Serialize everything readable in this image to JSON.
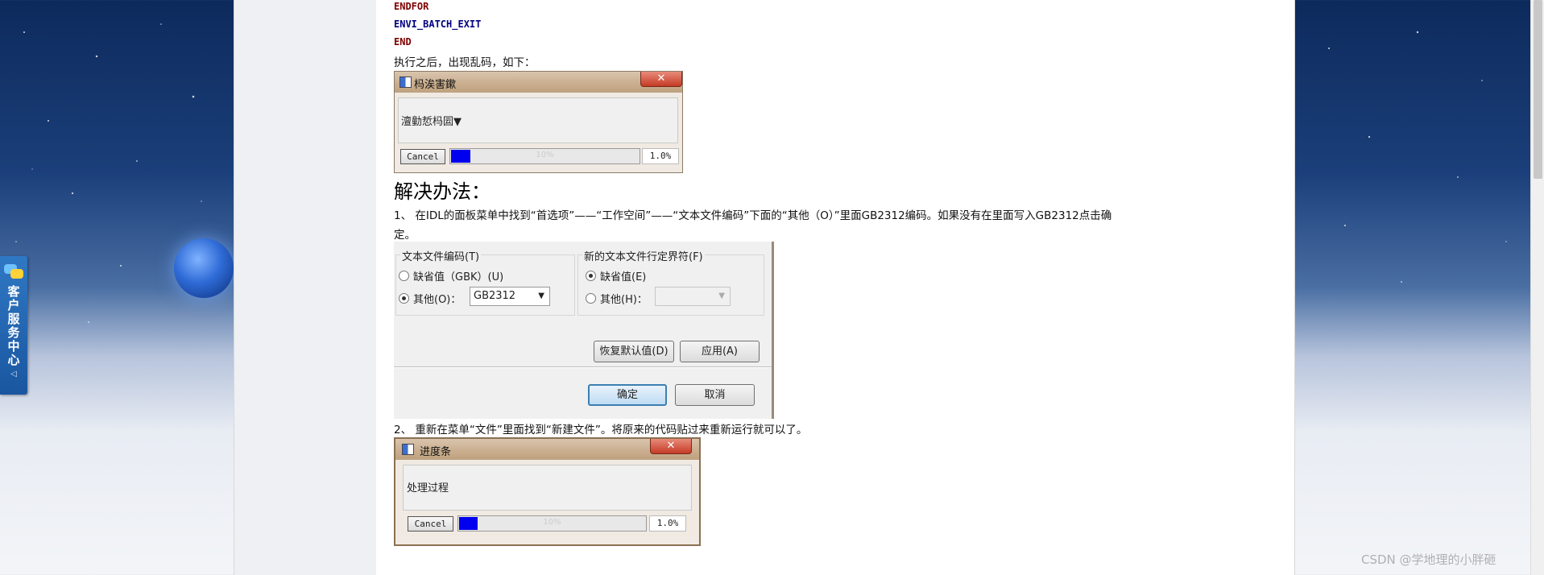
{
  "side_widget": {
    "label": "客户服务中心",
    "arrow": "◁"
  },
  "code_lines": [
    "ENDFOR",
    "ENVI_BATCH_EXIT",
    "END"
  ],
  "para_garbled": "执行之后，出现乱码，如下：",
  "dialog_garbled": {
    "title": "杩涘害鏉",
    "message": "澶勭悊杩囩▼",
    "cancel": "Cancel",
    "progress_faint": "10%",
    "progress": 0.1,
    "percent": "1.0%"
  },
  "heading": "解决办法：",
  "step1_line1": "1、  在IDL的面板菜单中找到“首选项”——“工作空间”——“文本文件编码”下面的“其他（O）”里面GB2312编码。如果没有在里面写入GB2312点击确",
  "step1_line2": "定。",
  "prefs": {
    "encoding_group": "文本文件编码(T)",
    "default_gbk": "缺省值（GBK）(U)",
    "other_o": "其他(O)：",
    "encoding_value": "GB2312",
    "eol_group": "新的文本文件行定界符(F)",
    "eol_default": "缺省值(E)",
    "eol_other": "其他(H)：",
    "eol_value": "",
    "restore_defaults": "恢复默认值(D)",
    "apply": "应用(A)",
    "ok": "确定",
    "cancel": "取消"
  },
  "step2": "2、  重新在菜单“文件”里面找到“新建文件”。将原来的代码贴过来重新运行就可以了。",
  "dialog_fixed": {
    "title": "进度条",
    "message": "处理过程",
    "cancel": "Cancel",
    "progress_faint": "10%",
    "progress": 0.1,
    "percent": "1.0%"
  },
  "watermark": "CSDN @学地理的小胖砸",
  "colors": {
    "keyword_red": "#800000",
    "keyword_blue": "#000080",
    "progress_fill": "#0000ee"
  }
}
